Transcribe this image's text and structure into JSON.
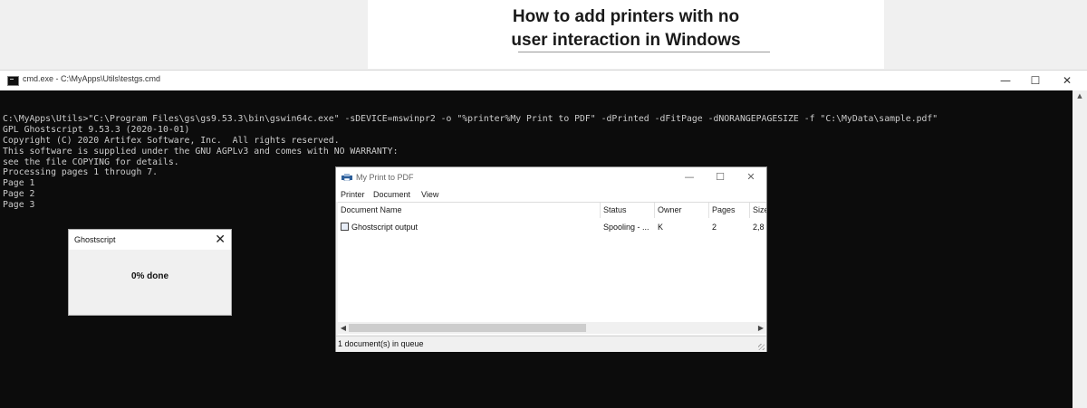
{
  "banner": {
    "title_line1": "How to add printers with no",
    "title_line2": "user interaction in Windows"
  },
  "cmd_window": {
    "title": "cmd.exe - C:\\MyApps\\Utils\\testgs.cmd",
    "icon": "console-icon",
    "controls": {
      "minimize": "—",
      "maximize": "☐",
      "close": "✕"
    },
    "lines": [
      "C:\\MyApps\\Utils>\"C:\\Program Files\\gs\\gs9.53.3\\bin\\gswin64c.exe\" -sDEVICE=mswinpr2 -o \"%printer%My Print to PDF\" -dPrinted -dFitPage -dNORANGEPAGESIZE -f \"C:\\MyData\\sample.pdf\"",
      "GPL Ghostscript 9.53.3 (2020-10-01)",
      "Copyright (C) 2020 Artifex Software, Inc.  All rights reserved.",
      "This software is supplied under the GNU AGPLv3 and comes with NO WARRANTY:",
      "see the file COPYING for details.",
      "Processing pages 1 through 7.",
      "Page 1",
      "Page 2",
      "Page 3"
    ],
    "text_color": "#cccccc",
    "background": "#0c0c0c"
  },
  "ghostscript_dialog": {
    "title": "Ghostscript",
    "close": "✕",
    "progress_text": "0% done"
  },
  "print_queue": {
    "title": "My Print to PDF",
    "controls": {
      "minimize": "—",
      "maximize": "☐",
      "close": "✕"
    },
    "menu": [
      "Printer",
      "Document",
      "View"
    ],
    "columns": [
      "Document Name",
      "Status",
      "Owner",
      "Pages",
      "Size"
    ],
    "rows": [
      {
        "document_name": "Ghostscript output",
        "status": "Spooling - ...",
        "owner": "K",
        "pages": "2",
        "size": "2,8"
      }
    ],
    "status_bar": "1 document(s) in queue"
  }
}
